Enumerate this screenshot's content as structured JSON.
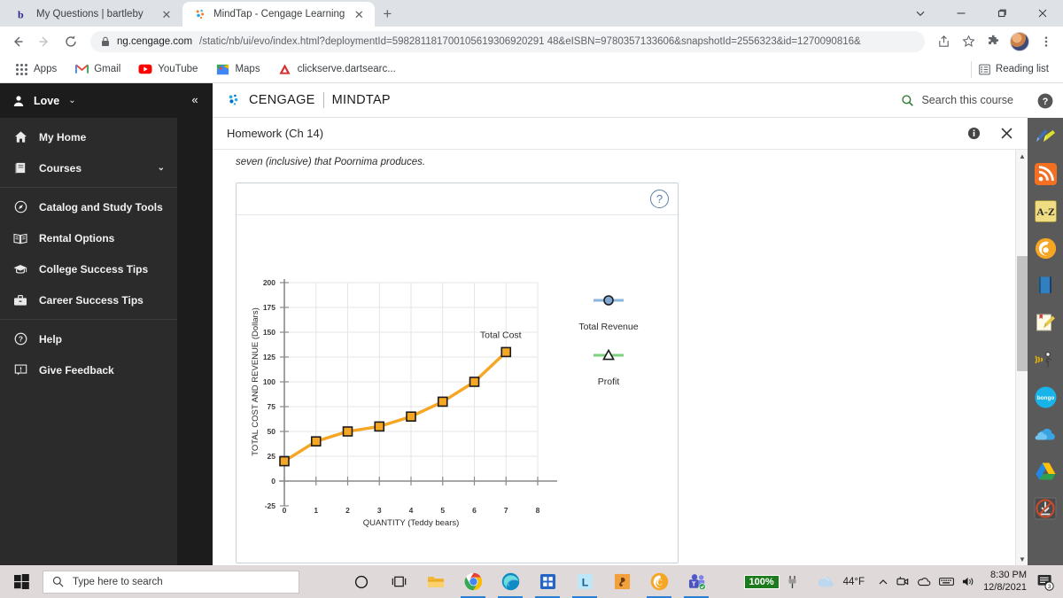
{
  "browser": {
    "tabs": [
      {
        "title": "My Questions | bartleby",
        "favicon": "bartleby-b-icon",
        "active": false
      },
      {
        "title": "MindTap - Cengage Learning",
        "favicon": "cengage-icon",
        "active": true
      }
    ],
    "new_tab_label": "+",
    "window_controls": {
      "chevron": "⌄",
      "minimize": "—",
      "maximize": "❐",
      "close": "✕"
    },
    "omnibox": {
      "host": "ng.cengage.com",
      "path": "/static/nb/ui/evo/index.html?deploymentId=598281181700105619306920291 48&eISBN=9780357133606&snapshotId=2556323&id=1270090816&",
      "full_url": "ng.cengage.com/static/nb/ui/evo/index.html?deploymentId=598281181700105619306920291 48&eISBN=9780357133606&snapshotId=2556323&id=1270090816&"
    },
    "bookmarks": [
      {
        "label": "Apps",
        "icon": "apps-grid-icon"
      },
      {
        "label": "Gmail",
        "icon": "gmail-icon"
      },
      {
        "label": "YouTube",
        "icon": "youtube-icon"
      },
      {
        "label": "Maps",
        "icon": "maps-icon"
      },
      {
        "label": "clickserve.dartsearc...",
        "icon": "adobe-a-icon"
      }
    ],
    "reading_list": "Reading list"
  },
  "sidebar": {
    "user": {
      "name": "Love",
      "chevron": "⌄"
    },
    "collapse": "«",
    "items": [
      {
        "label": "My Home",
        "icon": "home-icon",
        "chevron": ""
      },
      {
        "label": "Courses",
        "icon": "book-icon",
        "chevron": "⌄"
      },
      {
        "label": "Catalog and Study Tools",
        "icon": "compass-icon",
        "chevron": ""
      },
      {
        "label": "Rental Options",
        "icon": "open-book-icon",
        "chevron": ""
      },
      {
        "label": "College Success Tips",
        "icon": "graduation-cap-icon",
        "chevron": ""
      },
      {
        "label": "Career Success Tips",
        "icon": "briefcase-icon",
        "chevron": ""
      },
      {
        "label": "Help",
        "icon": "question-circle-icon",
        "chevron": ""
      },
      {
        "label": "Give Feedback",
        "icon": "feedback-icon",
        "chevron": ""
      }
    ]
  },
  "header": {
    "brand_cengage": "CENGAGE",
    "brand_mindtap": "MINDTAP",
    "search_label": "Search this course"
  },
  "activity": {
    "title": "Homework (Ch 14)",
    "info_icon": "info-icon",
    "close_icon": "close-icon"
  },
  "question": {
    "text": "seven (inclusive) that Poornima produces."
  },
  "chart_panel": {
    "help_icon": "?"
  },
  "chart_data": {
    "type": "line",
    "title": "",
    "xlabel": "QUANTITY (Teddy bears)",
    "ylabel": "TOTAL COST AND REVENUE (Dollars)",
    "xlim": [
      0,
      8
    ],
    "ylim": [
      -25,
      200
    ],
    "xticks": [
      0,
      1,
      2,
      3,
      4,
      5,
      6,
      7,
      8
    ],
    "yticks": [
      -25,
      0,
      25,
      50,
      75,
      100,
      125,
      150,
      175,
      200
    ],
    "grid": true,
    "series": [
      {
        "name": "Total Cost",
        "color": "#F5A623",
        "marker": "square",
        "plotted": true,
        "inline_label": "Total Cost",
        "x": [
          0,
          1,
          2,
          3,
          4,
          5,
          6,
          7
        ],
        "values": [
          20,
          40,
          50,
          55,
          65,
          80,
          100,
          130
        ]
      },
      {
        "name": "Total Revenue",
        "color": "#8CB4DC",
        "marker": "circle",
        "plotted": false,
        "x": [],
        "values": []
      },
      {
        "name": "Profit",
        "color": "#7ED07E",
        "marker": "triangle",
        "plotted": false,
        "x": [],
        "values": []
      }
    ],
    "legend": [
      {
        "label": "Total Revenue",
        "color": "#8CB4DC",
        "marker": "circle"
      },
      {
        "label": "Profit",
        "color": "#7ED07E",
        "marker": "triangle"
      }
    ],
    "legend_position": "right"
  },
  "rail": {
    "items": [
      {
        "name": "help-icon"
      },
      {
        "name": "pen-highlighter-icon"
      },
      {
        "name": "rss-feed-icon"
      },
      {
        "name": "a-z-dictionary-icon",
        "label": "A-Z"
      },
      {
        "name": "bookshelf-six-icon"
      },
      {
        "name": "ebook-icon"
      },
      {
        "name": "notepad-pencil-icon"
      },
      {
        "name": "read-aloud-icon"
      },
      {
        "name": "bongo-icon",
        "label": "bongo"
      },
      {
        "name": "onedrive-cloud-icon"
      },
      {
        "name": "google-drive-icon"
      },
      {
        "name": "download-blocked-icon"
      }
    ]
  },
  "taskbar": {
    "start_icon": "windows-start-icon",
    "search_placeholder": "Type here to search",
    "apps": [
      {
        "name": "cortana-icon"
      },
      {
        "name": "task-view-icon"
      },
      {
        "name": "file-explorer-icon"
      },
      {
        "name": "chrome-icon",
        "open": true
      },
      {
        "name": "edge-icon",
        "open": true
      },
      {
        "name": "microsoft-store-icon",
        "open": true
      },
      {
        "name": "logitech-icon",
        "open": true
      },
      {
        "name": "paint-icon"
      },
      {
        "name": "cengage-icon",
        "open": true
      },
      {
        "name": "microsoft-teams-icon",
        "open": true
      }
    ],
    "tray": {
      "battery_percent": "100%",
      "charging_icon": "plug-icon",
      "weather_temp": "44°F",
      "weather_icon": "cloud-icon",
      "chevron_up": "∧",
      "camera_icon": "camera-icon",
      "onedrive_icon": "onedrive-icon",
      "keyboard_icon": "keyboard-icon",
      "volume_icon": "speaker-icon",
      "time": "8:30 PM",
      "date": "12/8/2021",
      "notification_count": "3"
    }
  }
}
